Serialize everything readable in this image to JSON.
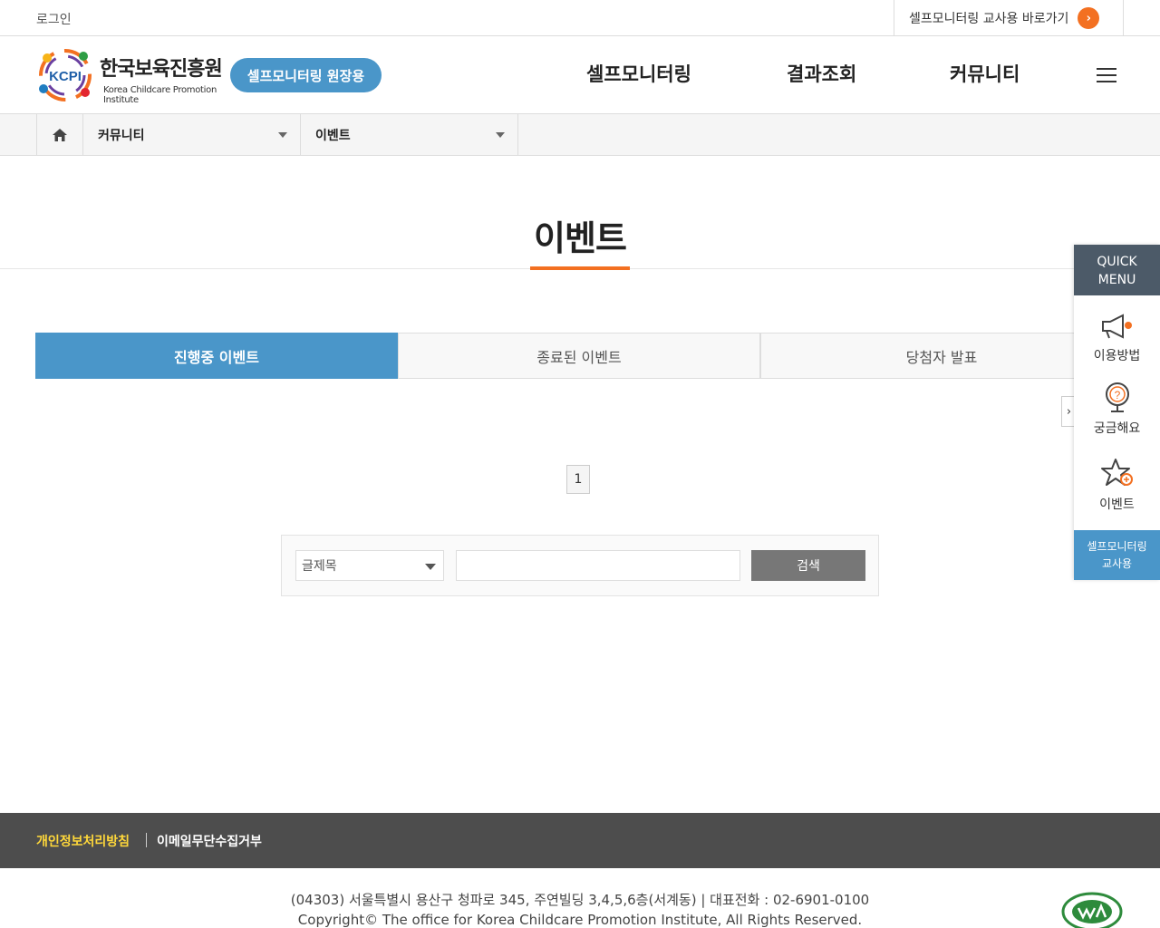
{
  "topbar": {
    "login": "로그인",
    "teacher_link": "셀프모니터링 교사용 바로가기"
  },
  "header": {
    "logo_abbr": "KCPI",
    "logo_kname": "한국보육진흥원",
    "logo_ename": "Korea Childcare Promotion Institute",
    "role_badge": "셀프모니터링 원장용",
    "nav": [
      "셀프모니터링",
      "결과조회",
      "커뮤니티"
    ]
  },
  "breadcrumb": {
    "level1": "커뮤니티",
    "level2": "이벤트"
  },
  "page_title": "이벤트",
  "tabs": [
    {
      "label": "진행중 이벤트",
      "active": true
    },
    {
      "label": "종료된 이벤트",
      "active": false
    },
    {
      "label": "당첨자 발표",
      "active": false
    }
  ],
  "pagination": {
    "current": "1"
  },
  "search": {
    "field_selected": "글제목",
    "query": "",
    "button": "검색"
  },
  "quick_menu": {
    "title_line1": "QUICK",
    "title_line2": "MENU",
    "items": [
      "이용방법",
      "궁금해요",
      "이벤트"
    ],
    "footer_line1": "셀프모니터링",
    "footer_line2": "교사용"
  },
  "footer": {
    "privacy": "개인정보처리방침",
    "email_refusal": "이메일무단수집거부",
    "address": "(04303) 서울특별시 용산구 청파로 345, 주연빌딩 3,4,5,6층(서계동) | 대표전화 : 02-6901-0100",
    "copyright": "Copyright© The office for Korea Childcare Promotion Institute, All Rights Reserved."
  },
  "colors": {
    "accent_blue": "#4a96c9",
    "accent_orange": "#f37021",
    "footer_bg": "#4d4d4d",
    "quick_head": "#4c5a68"
  }
}
